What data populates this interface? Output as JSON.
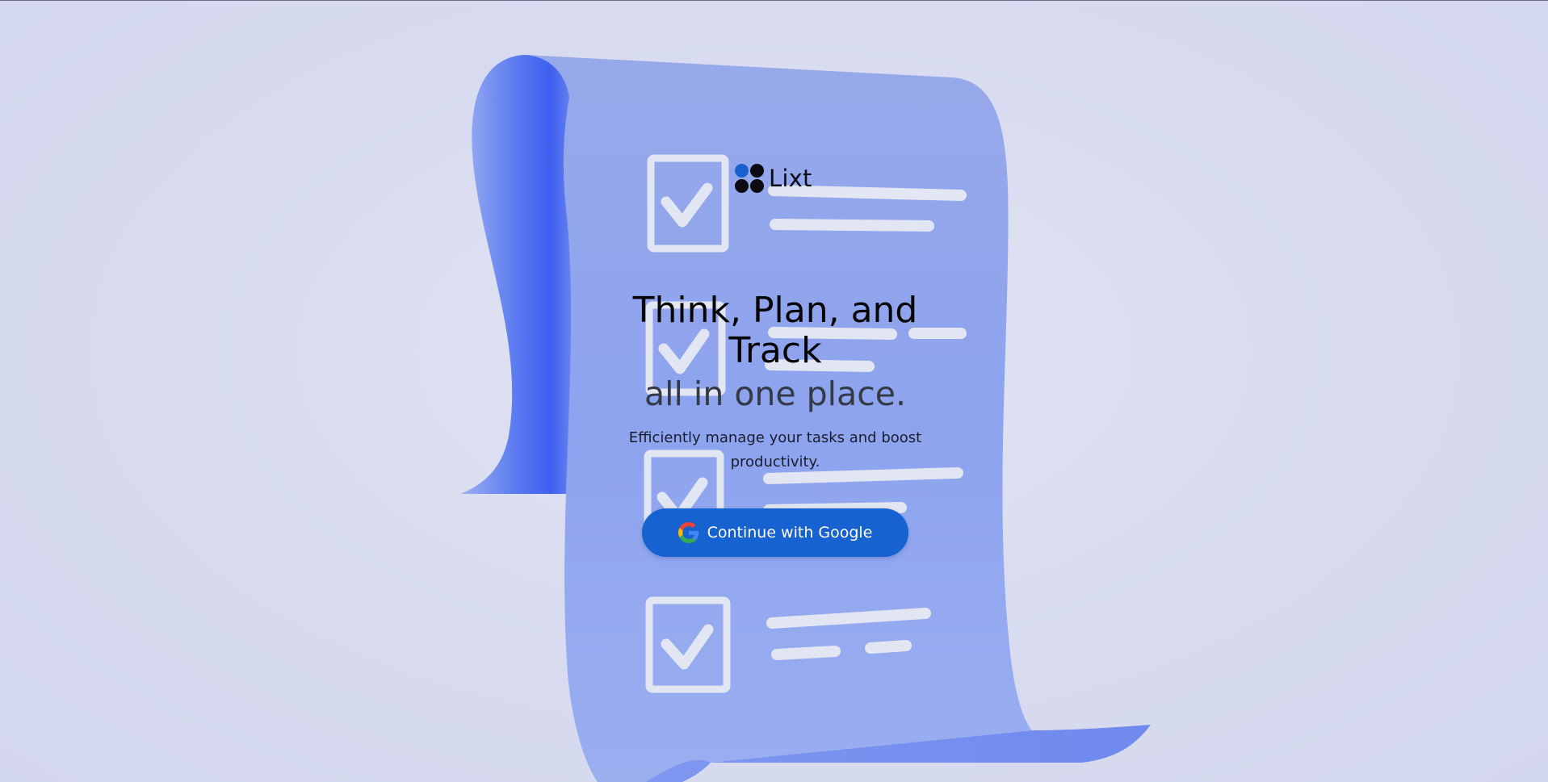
{
  "brand": {
    "name": "Lixt",
    "logo_icon": "four-dots-logo-icon"
  },
  "hero": {
    "headline": "Think, Plan, and Track",
    "subheadline": "all in one place.",
    "description": "Efficiently manage your tasks and boost productivity."
  },
  "auth": {
    "google_button_label": "Continue with Google",
    "google_icon": "google-g-icon"
  },
  "illustration": {
    "subject": "checklist-scroll-illustration",
    "checkbox_icon": "checkmark-icon"
  },
  "colors": {
    "background": "#d9dcf0",
    "scroll": "#8fa4ec",
    "button": "#1662d0",
    "headline": "#050505",
    "subheadline": "#333a45"
  }
}
